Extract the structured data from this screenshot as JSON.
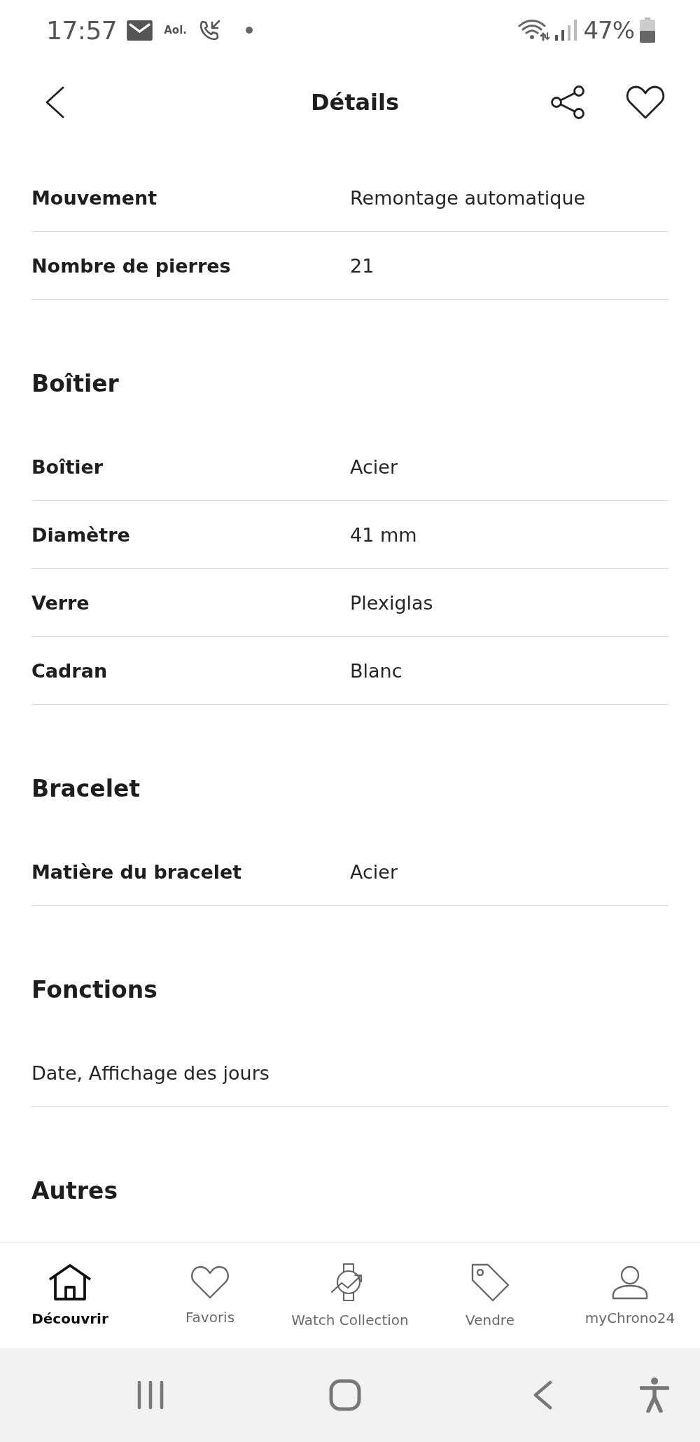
{
  "status_bar": {
    "time": "17:57",
    "notification_label": "Aol.",
    "battery": "47%"
  },
  "header": {
    "title": "Détails"
  },
  "sections": [
    {
      "rows": [
        {
          "kind": "pair",
          "label": "Mouvement",
          "value": "Remontage automatique"
        },
        {
          "kind": "pair",
          "label": "Nombre de pierres",
          "value": "21"
        }
      ]
    },
    {
      "heading": "Boîtier",
      "rows": [
        {
          "kind": "pair",
          "label": "Boîtier",
          "value": "Acier"
        },
        {
          "kind": "pair",
          "label": "Diamètre",
          "value": "41 mm"
        },
        {
          "kind": "pair",
          "label": "Verre",
          "value": "Plexiglas"
        },
        {
          "kind": "pair",
          "label": "Cadran",
          "value": "Blanc"
        }
      ]
    },
    {
      "heading": "Bracelet",
      "rows": [
        {
          "kind": "pair",
          "label": "Matière du bracelet",
          "value": "Acier"
        }
      ]
    },
    {
      "heading": "Fonctions",
      "rows": [
        {
          "kind": "text",
          "value": "Date, Affichage des jours"
        }
      ]
    },
    {
      "heading": "Autres"
    }
  ],
  "bottom_nav": [
    {
      "label": "Découvrir",
      "selected": true
    },
    {
      "label": "Favoris",
      "selected": false
    },
    {
      "label": "Watch Collection",
      "selected": false
    },
    {
      "label": "Vendre",
      "selected": false
    },
    {
      "label": "myChrono24",
      "selected": false
    }
  ]
}
